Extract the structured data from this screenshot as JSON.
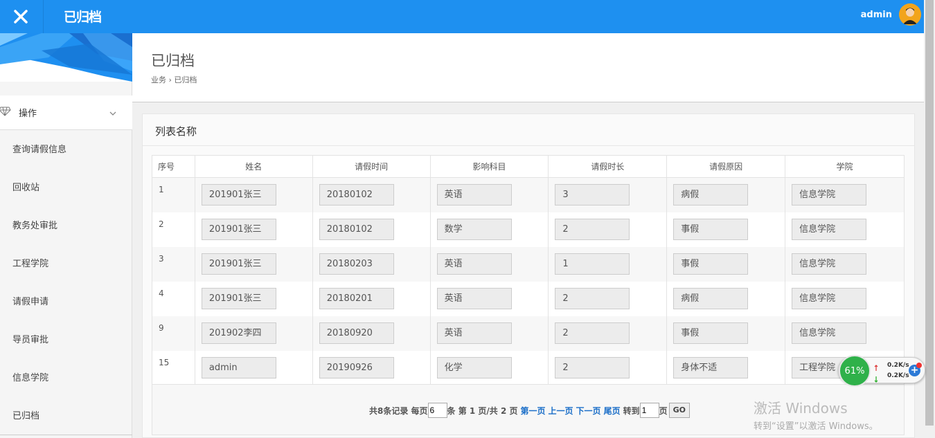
{
  "header": {
    "app_title": "已归档",
    "user": "admin"
  },
  "sidebar": {
    "group_label": "操作",
    "items": [
      {
        "label": "查询请假信息"
      },
      {
        "label": "回收站"
      },
      {
        "label": "教务处审批"
      },
      {
        "label": "工程学院"
      },
      {
        "label": "请假申请"
      },
      {
        "label": "导员审批"
      },
      {
        "label": "信息学院"
      },
      {
        "label": "已归档"
      }
    ]
  },
  "page": {
    "title": "已归档",
    "breadcrumb": "业务 › 已归档"
  },
  "panel": {
    "title": "列表名称"
  },
  "table": {
    "columns": [
      "序号",
      "姓名",
      "请假时间",
      "影响科目",
      "请假时长",
      "请假原因",
      "学院"
    ],
    "rows": [
      {
        "id": "1",
        "name": "201901张三",
        "date": "20180102",
        "subject": "英语",
        "duration": "3",
        "reason": "病假",
        "college": "信息学院"
      },
      {
        "id": "2",
        "name": "201901张三",
        "date": "20180102",
        "subject": "数学",
        "duration": "2",
        "reason": "事假",
        "college": "信息学院"
      },
      {
        "id": "3",
        "name": "201901张三",
        "date": "20180203",
        "subject": "英语",
        "duration": "1",
        "reason": "事假",
        "college": "信息学院"
      },
      {
        "id": "4",
        "name": "201901张三",
        "date": "20180201",
        "subject": "英语",
        "duration": "2",
        "reason": "病假",
        "college": "信息学院"
      },
      {
        "id": "9",
        "name": "201902李四",
        "date": "20180920",
        "subject": "英语",
        "duration": "2",
        "reason": "事假",
        "college": "信息学院"
      },
      {
        "id": "15",
        "name": "admin",
        "date": "20190926",
        "subject": "化学",
        "duration": "2",
        "reason": "身体不适",
        "college": "工程学院"
      }
    ]
  },
  "pager": {
    "total_text": "共8条记录 每页",
    "per_page": "6",
    "page_info": "条 第 1 页/共 2 页",
    "first": "第一页",
    "prev": "上一页",
    "next": "下一页",
    "last": "尾页",
    "goto_label": "转到",
    "goto_value": "1",
    "page_suffix": "页",
    "go": "GO"
  },
  "watermark": {
    "line1": "激活 Windows",
    "line2": "转到“设置”以激活 Windows。"
  },
  "netmonitor": {
    "percent": "61%",
    "up": "0.2K/s",
    "down": "0.2K/s"
  },
  "colors": {
    "topbar": "#1e90f0",
    "link": "#1a6ec8",
    "net_ball": "#2fb14a"
  }
}
